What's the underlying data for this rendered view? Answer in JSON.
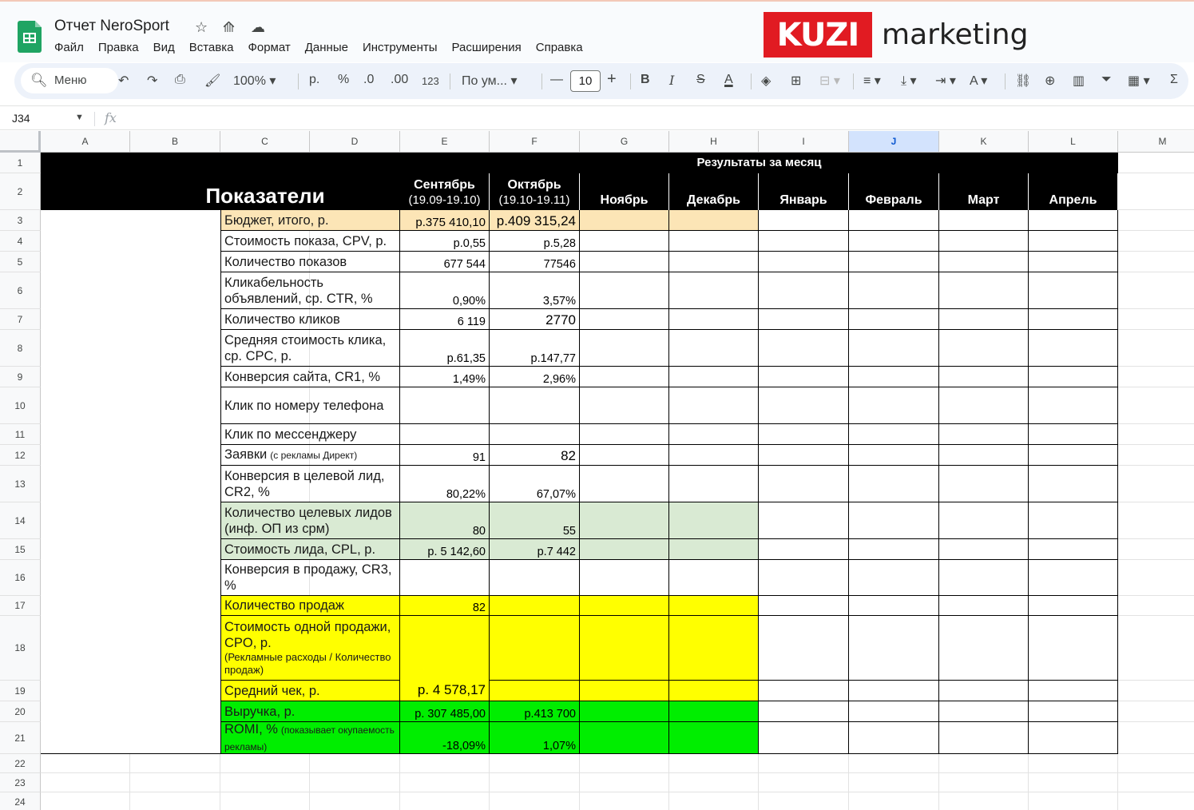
{
  "app": {
    "doc_title": "Отчет NeroSport",
    "menu": [
      "Файл",
      "Правка",
      "Вид",
      "Вставка",
      "Формат",
      "Данные",
      "Инструменты",
      "Расширения",
      "Справка"
    ]
  },
  "brand": {
    "box_text": "KUZI",
    "word": "marketing",
    "color": "#e11b22"
  },
  "toolbar": {
    "search_label": "Меню",
    "zoom": "100%",
    "currency": "р.",
    "percent": "%",
    "dec_decrease": ".0",
    "dec_increase": ".00",
    "number_format": "123",
    "font": "По ум...",
    "font_size": "10",
    "icons": [
      "search-icon",
      "undo-icon",
      "redo-icon",
      "print-icon",
      "paint-format-icon",
      "bold-icon",
      "italic-icon",
      "strikethrough-icon",
      "text-color-icon",
      "fill-color-icon",
      "borders-icon",
      "merge-icon",
      "align-icon",
      "valign-icon",
      "text-wrap-icon",
      "text-rotate-icon",
      "link-icon",
      "comment-icon",
      "chart-icon",
      "filter-icon",
      "table-icon",
      "sum-icon"
    ]
  },
  "formula_bar": {
    "cell_ref": "J34",
    "fx": "fx",
    "value": ""
  },
  "columns": [
    "A",
    "B",
    "C",
    "D",
    "E",
    "F",
    "G",
    "H",
    "I",
    "J",
    "K",
    "L",
    "M"
  ],
  "selected_column": "J",
  "sheet": {
    "title": "Показатели",
    "results_header": "Результаты за месяц",
    "months": [
      {
        "name": "Сентябрь",
        "sub": "(19.09-19.10)"
      },
      {
        "name": "Октябрь",
        "sub": "(19.10-19.11)"
      },
      {
        "name": "Ноябрь",
        "sub": ""
      },
      {
        "name": "Декабрь",
        "sub": ""
      },
      {
        "name": "Январь",
        "sub": ""
      },
      {
        "name": "Февраль",
        "sub": ""
      },
      {
        "name": "Март",
        "sub": ""
      },
      {
        "name": "Апрель",
        "sub": ""
      }
    ],
    "rows": [
      {
        "n": "3",
        "label": "Бюджет, итого, р.",
        "note": "",
        "sep": "р.375 410,10",
        "oct": "р.409 315,24"
      },
      {
        "n": "4",
        "label": "Стоимость показа, CPV, р.",
        "note": "",
        "sep": "р.0,55",
        "oct": "р.5,28"
      },
      {
        "n": "5",
        "label": "Количество показов",
        "note": "",
        "sep": "677 544",
        "oct": "77546"
      },
      {
        "n": "6",
        "label": "Кликабельность объявлений, ср. CTR, %",
        "note": "",
        "sep": "0,90%",
        "oct": "3,57%"
      },
      {
        "n": "7",
        "label": "Количество кликов",
        "note": "",
        "sep": "6 119",
        "oct": "2770"
      },
      {
        "n": "8",
        "label": "Средняя стоимость клика, ср. CPC, р.",
        "note": "",
        "sep": "р.61,35",
        "oct": "р.147,77"
      },
      {
        "n": "9",
        "label": "Конверсия сайта, CR1, %",
        "note": "",
        "sep": "1,49%",
        "oct": "2,96%"
      },
      {
        "n": "10",
        "label": "Клик по номеру телефона",
        "note": "",
        "sep": "",
        "oct": ""
      },
      {
        "n": "11",
        "label": "Клик по мессенджеру",
        "note": "",
        "sep": "",
        "oct": ""
      },
      {
        "n": "12",
        "label": "Заявки",
        "note": "(с рекламы Директ)",
        "sep": "91",
        "oct": "82"
      },
      {
        "n": "13",
        "label": "Конверсия в целевой лид, CR2, %",
        "note": "",
        "sep": "80,22%",
        "oct": "67,07%"
      },
      {
        "n": "14",
        "label": "Количество целевых лидов (инф. ОП из срм)",
        "note": "",
        "sep": "80",
        "oct": "55"
      },
      {
        "n": "15",
        "label": "Стоимость лида, CPL, р.",
        "note": "",
        "sep": "р. 5 142,60",
        "oct": "р.7 442"
      },
      {
        "n": "16",
        "label": "Конверсия в продажу, CR3, %",
        "note": "",
        "sep": "",
        "oct": ""
      },
      {
        "n": "17",
        "label": "Количество продаж",
        "note": "",
        "sep": "82",
        "oct": ""
      },
      {
        "n": "18",
        "label": "Стоимость одной продажи, CPO, р.",
        "note": "(Рекламные расходы / Количество продаж)",
        "sep": "р. 4 578,17",
        "oct": ""
      },
      {
        "n": "19",
        "label": "Средний чек, р.",
        "note": "",
        "sep": "",
        "oct": ""
      },
      {
        "n": "20",
        "label": "Выручка, р.",
        "note": "",
        "sep": "р. 307 485,00",
        "oct": "р.413 700"
      },
      {
        "n": "21",
        "label": "ROMI, %",
        "note": "(показывает окупаемость рекламы)",
        "sep": "-18,09%",
        "oct": "1,07%"
      }
    ],
    "extra_rows": [
      "1",
      "2",
      "22",
      "23",
      "24"
    ],
    "colors": {
      "header_bg": "#000000",
      "budget": "#fce5b6",
      "leads": "#d9ead3",
      "sales": "#ffff00",
      "revenue": "#00ee00",
      "selected_col": "#d3e3fd"
    }
  }
}
